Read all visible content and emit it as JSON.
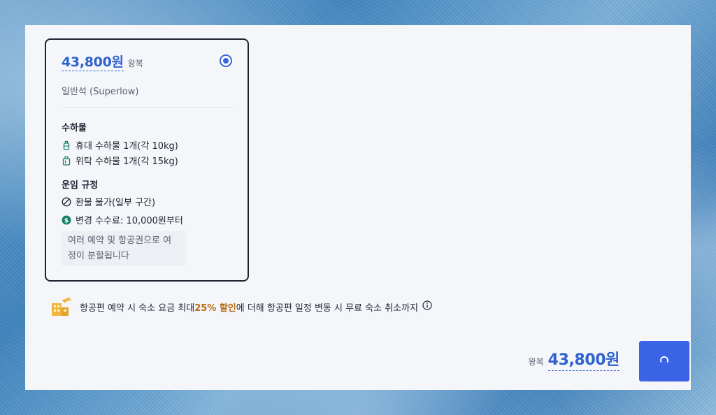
{
  "fare_card": {
    "price": "43,800원",
    "trip_type": "왕복",
    "selected": true,
    "cabin_class": "일반석 (Superlow)",
    "baggage": {
      "title": "수하물",
      "items": [
        {
          "icon": "carry-on-bag-icon",
          "label": "휴대 수하물 1개(각 10kg)"
        },
        {
          "icon": "checked-bag-icon",
          "label": "위탁 수하물 1개(각 15kg)"
        }
      ]
    },
    "fare_rules": {
      "title": "운임 규정",
      "items": [
        {
          "icon": "no-refund-icon",
          "label": "환불 불가(일부 구간)"
        },
        {
          "icon": "dollar-icon",
          "label": "변경 수수료: 10,000원부터"
        }
      ],
      "note": "여러 예약 및 항공권으로 여정이 분할됩니다"
    }
  },
  "promo": {
    "text_before": "항공편 예약 시 숙소 요금 최대 ",
    "highlight": "25% 할인",
    "text_after": "에 더해 항공편 일정 변동 시 무료 숙소 취소까지"
  },
  "footer": {
    "total_label": "왕복",
    "total_price": "43,800원"
  },
  "colors": {
    "accent": "#2f62cf",
    "button": "#3b63e6",
    "highlight": "#b86a10"
  }
}
